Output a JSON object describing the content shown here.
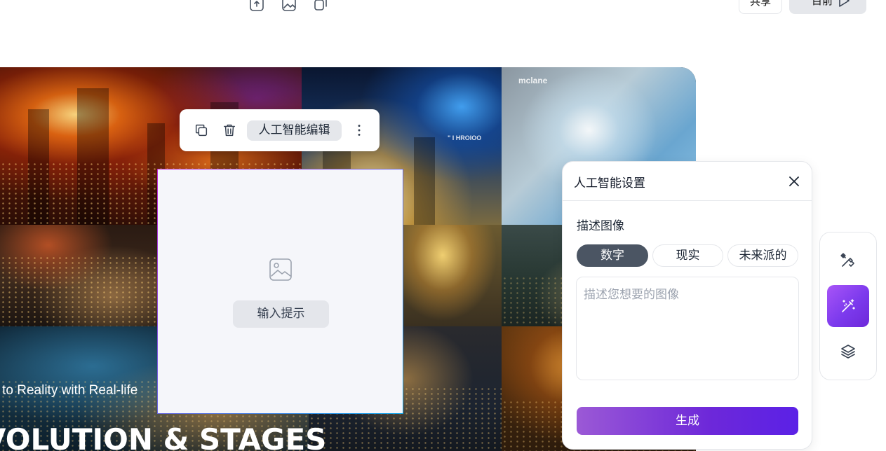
{
  "topbar": {
    "share_label": "共享",
    "present_label": "目前",
    "icons": [
      "export-icon",
      "image-icon",
      "duplicate-icon"
    ]
  },
  "slide": {
    "tile_caption_1": "mclane",
    "tile_caption_2": "\" I HROIOO",
    "subtitle": "ot to Reality with Real-life",
    "title": "VOLUTION & STAGES"
  },
  "float_toolbar": {
    "ai_edit_label": "人工智能编辑",
    "icons": [
      "copy-icon",
      "trash-icon",
      "more-vertical-icon"
    ]
  },
  "placeholder": {
    "button_label": "输入提示",
    "icon": "image-icon"
  },
  "ai_panel": {
    "title": "人工智能设置",
    "describe_label": "描述图像",
    "styles": [
      {
        "label": "数字",
        "active": true
      },
      {
        "label": "现实",
        "active": false
      },
      {
        "label": "未来派的",
        "active": false
      }
    ],
    "prompt_placeholder": "描述您想要的图像",
    "prompt_value": "",
    "generate_label": "生成"
  },
  "rail": {
    "items": [
      {
        "icon": "tools-icon",
        "active": false
      },
      {
        "icon": "magic-wand-icon",
        "active": true
      },
      {
        "icon": "layers-icon",
        "active": false
      }
    ],
    "accent": "#7c3aed"
  },
  "colors": {
    "active_tab": "#4b5563",
    "generate_gradient_start": "#9b59d6",
    "generate_gradient_end": "#5b21e6",
    "border": "#e5e7eb"
  }
}
